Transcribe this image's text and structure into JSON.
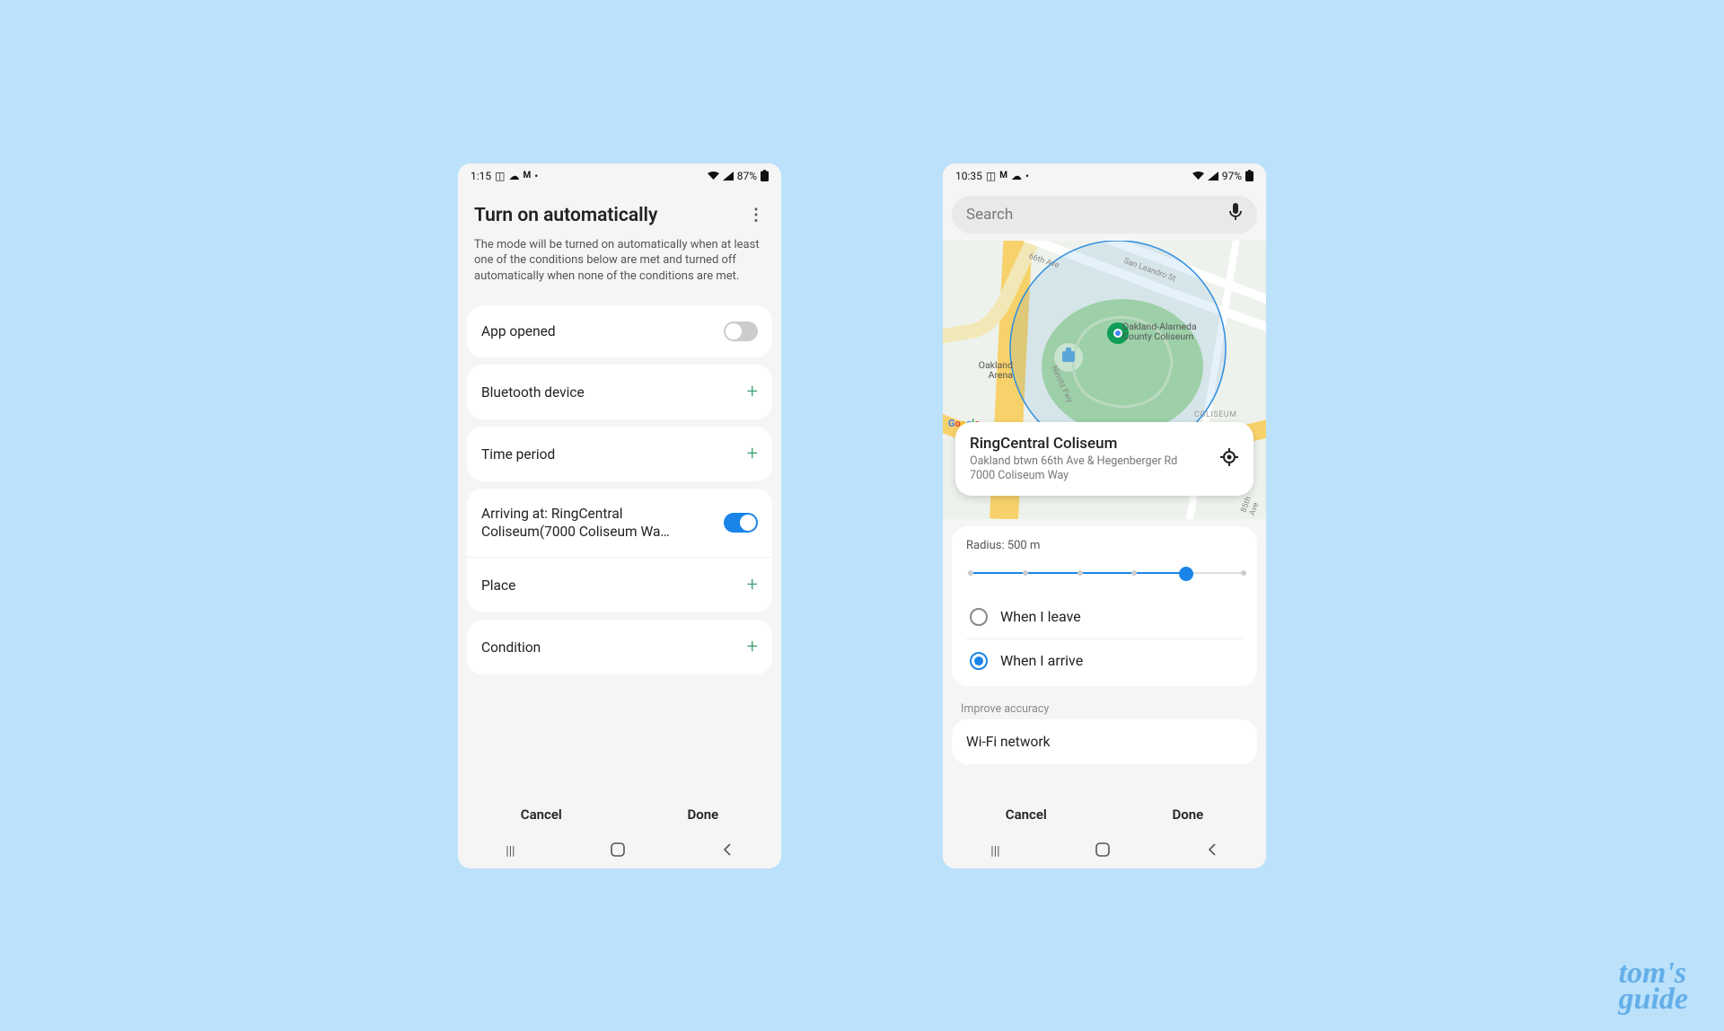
{
  "watermark": {
    "line1": "tom's",
    "line2": "guide"
  },
  "phone1": {
    "status": {
      "time": "1:15",
      "battery": "87%"
    },
    "title": "Turn on automatically",
    "description": "The mode will be turned on automatically when at least one of the conditions below are met and turned off automatically when none of the conditions are met.",
    "rows": {
      "appOpened": "App opened",
      "bluetooth": "Bluetooth device",
      "timePeriod": "Time period",
      "arriving": "Arriving at: RingCentral Coliseum(7000 Coliseum Wa…",
      "place": "Place",
      "condition": "Condition"
    },
    "buttons": {
      "cancel": "Cancel",
      "done": "Done"
    }
  },
  "phone2": {
    "status": {
      "time": "10:35",
      "battery": "97%"
    },
    "search_placeholder": "Search",
    "map_labels": {
      "road1": "66th Ave",
      "road2": "San Leandro St",
      "road3": "Nimitz Fwy",
      "road4": "85th Ave",
      "poi1": "Oakland Arena",
      "poi2": "Oakland-Alameda County Coliseum",
      "area1": "COLISEUM",
      "brand": "Google"
    },
    "place": {
      "title": "RingCentral Coliseum",
      "sub": "Oakland btwn 66th Ave & Hegenberger Rd 7000 Coliseum Way"
    },
    "radius": {
      "label": "Radius: 500 m",
      "ticks": 6,
      "selected_index": 4,
      "opt_leave": "When I leave",
      "opt_arrive": "When I arrive"
    },
    "improve_label": "Improve accuracy",
    "wifi": "Wi-Fi network",
    "buttons": {
      "cancel": "Cancel",
      "done": "Done"
    }
  }
}
